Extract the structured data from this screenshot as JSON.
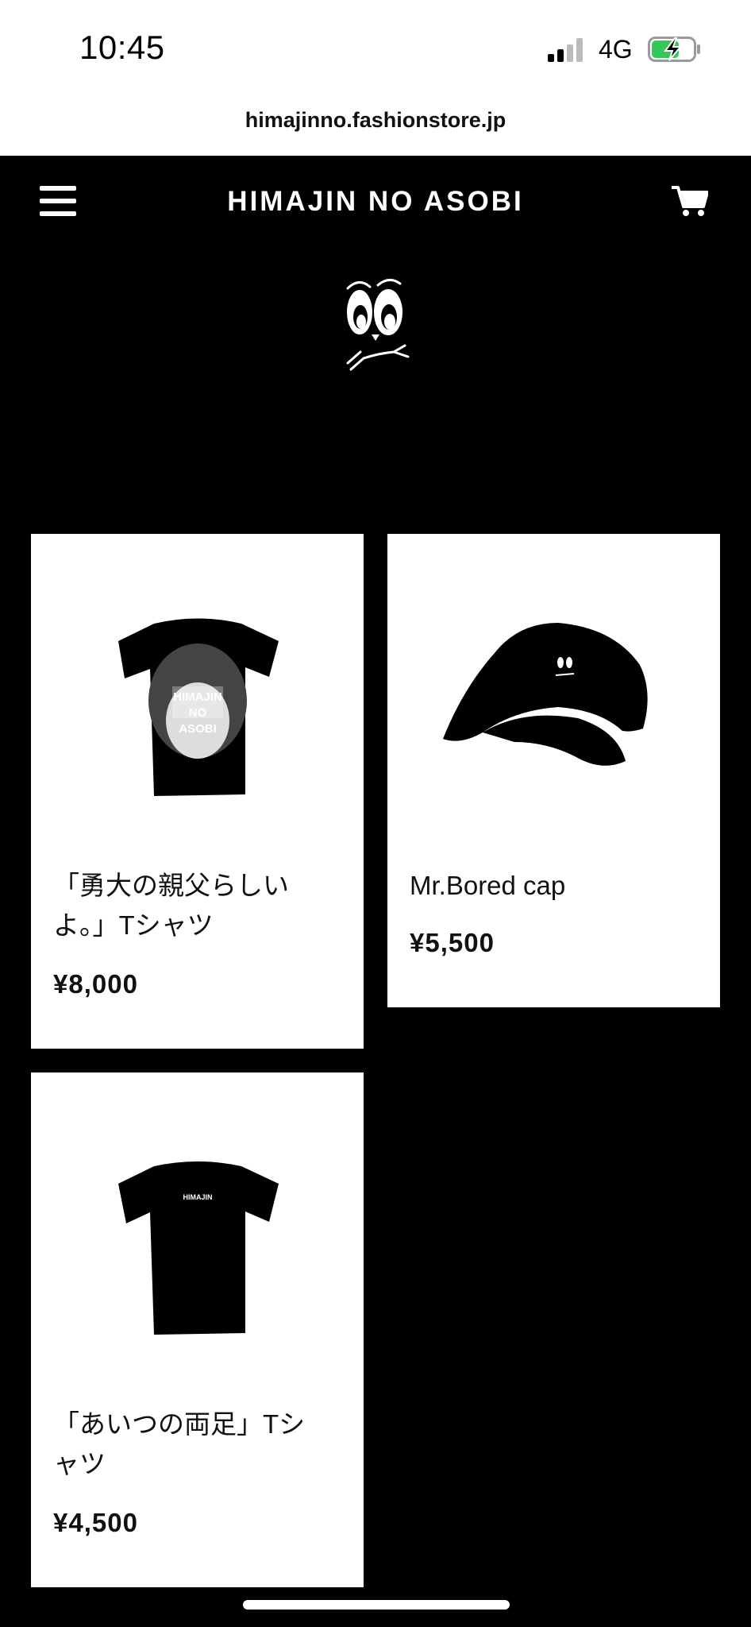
{
  "status_bar": {
    "time": "10:45",
    "network": "4G",
    "battery_color": "#34c759"
  },
  "browser": {
    "url": "himajinno.fashionstore.jp"
  },
  "header": {
    "title": "HIMAJIN NO ASOBI",
    "menu_icon": "hamburger-menu-icon",
    "cart_icon": "cart-icon"
  },
  "products": [
    {
      "name": "「勇大の親父らしいよ。」Tシャツ",
      "price": "¥8,000",
      "shirt_print": [
        "HIMAJIN",
        "NO",
        "ASOBI"
      ]
    },
    {
      "name": "Mr.Bored cap",
      "price": "¥5,500"
    },
    {
      "name": "「あいつの両足」Tシャツ",
      "price": "¥4,500",
      "shirt_print": "HIMAJIN"
    }
  ],
  "colors": {
    "background": "#000000",
    "card": "#ffffff",
    "text": "#111111"
  }
}
